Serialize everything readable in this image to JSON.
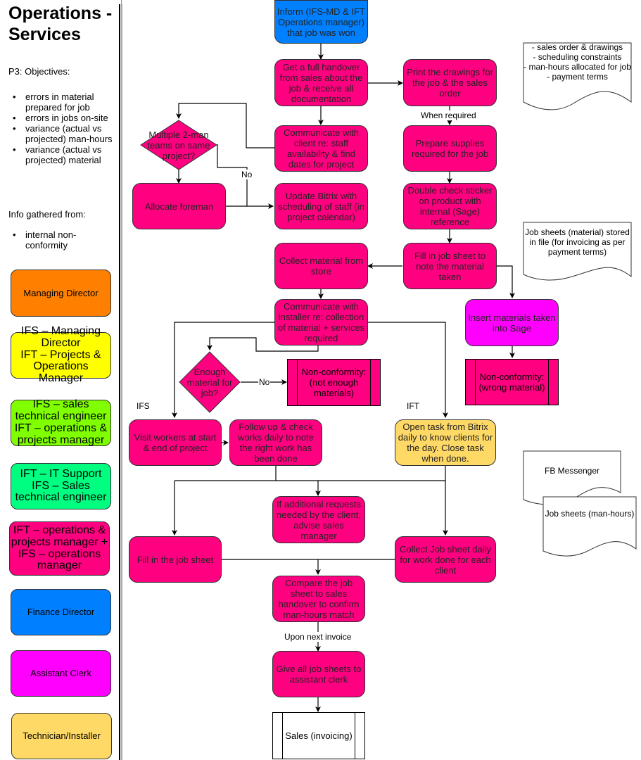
{
  "sidebar": {
    "title": "Operations - Services",
    "objectives_heading": "P3: Objectives:",
    "objectives": [
      "errors in material prepared for job",
      "errors in jobs on-site",
      "variance (actual vs projected) man-hours",
      "variance (actual vs projected) material"
    ],
    "info_heading": "Info gathered from:",
    "info_sources": [
      "internal non-conformity"
    ],
    "legend": [
      {
        "label": "Managing Director",
        "color": "#ff8000"
      },
      {
        "label": "IFS – Managing Director\nIFT – Projects & Operations Manager",
        "color": "#ffff00"
      },
      {
        "label": "IFS – sales technical engineer\nIFT – operations & projects manager",
        "color": "#80ff00"
      },
      {
        "label": "IFT – IT Support\nIFS – Sales technical engineer",
        "color": "#00ff80"
      },
      {
        "label": "IFT – operations & projects manager + IFS – operations manager",
        "color": "#ff0080"
      },
      {
        "label": "Finance Director",
        "color": "#0080ff"
      },
      {
        "label": "Assistant Clerk",
        "color": "#ff00ff"
      },
      {
        "label": "Technician/Installer",
        "color": "#ffd966"
      }
    ]
  },
  "flow": {
    "inform": "Inform (IFS-MD & IFT Operations manager) that job was won",
    "handover": "Get a full handover from sales about the job & receive all documentation",
    "print": "Print the drawings for the job & the sales order",
    "when_required": "When required",
    "prepare": "Prepare supplies required for the job",
    "double_check": "Double check sticker on product with internal (Sage) reference",
    "communicate_client": "Communicate with client re: staff availability & find dates for project",
    "multiple_teams": "Multiple 2-man teams on same project?",
    "no_label_1": "No",
    "allocate": "Allocate foreman",
    "update_bitrix": "Update Bitrix with scheduling of staff (in project calendar)",
    "collect_material": "Collect material from store",
    "fill_job_sheet_material": "Fill in job sheet to note the material taken",
    "insert_sage": "Insert materials taken into Sage",
    "nonconf_wrong": "Non-conformity: (wrong material)",
    "communicate_installer": "Communicate with installer re: collection of material + services required",
    "enough_material": "Enough material for job?",
    "no_label_2": "No",
    "nonconf_not_enough": "Non-conformity: (not enough materials)",
    "lane_ifs": "IFS",
    "lane_ift": "IFT",
    "visit_workers": "Visit workers at start & end of project",
    "follow_up": "Follow up & check works daily to note the right work has been done",
    "open_task": "Open task from Bitrix daily to know clients for the day. Close task when done.",
    "additional_requests": "If additional requests needed by the client, advise sales manager",
    "fill_job_sheet": "Fill in the job sheet",
    "collect_job_sheet": "Collect Job sheet daily for work done for each client",
    "compare": "Compare the job sheet to sales handover to confirm man-hours match",
    "upon_invoice": "Upon next invoice",
    "give_sheets": "Give all job sheets to assistant clerk",
    "sales_invoicing": "Sales (invoicing)"
  },
  "documents": {
    "handover_docs": "- sales order & drawings\n- scheduling constraints\n- man-hours allocated for job\n- payment terms",
    "job_sheets_material": "Job sheets (material) stored in file (for invoicing as per payment terms)",
    "fb_messenger": "FB Messenger",
    "job_sheets_manhours": "Job sheets (man-hours)"
  }
}
